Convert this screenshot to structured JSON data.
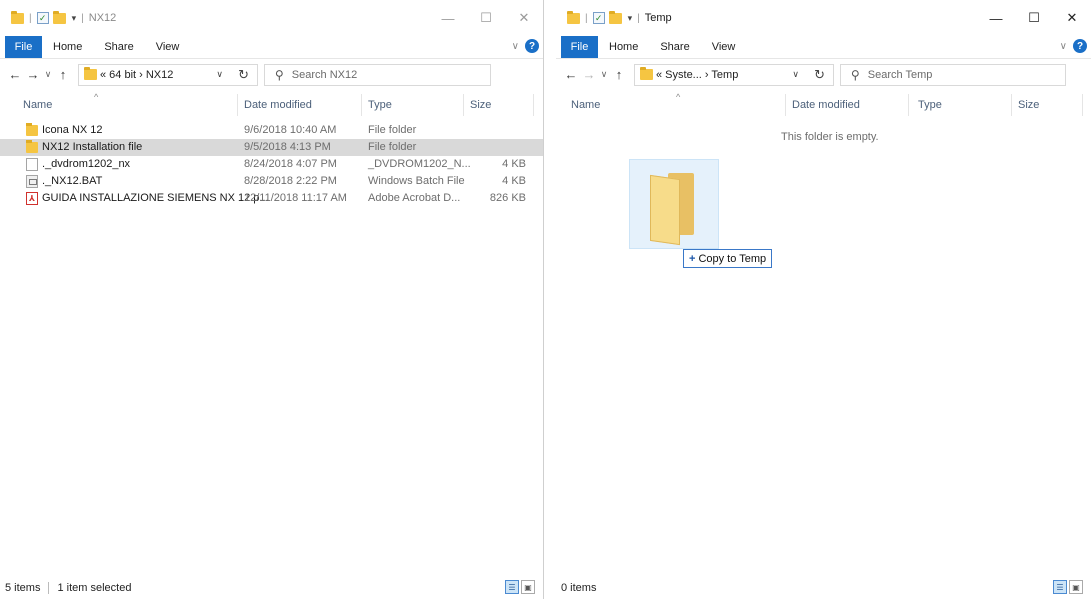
{
  "left": {
    "title": "NX12",
    "ribbon": {
      "file": "File",
      "home": "Home",
      "share": "Share",
      "view": "View"
    },
    "address": {
      "crumbs": "« 64 bit › NX12"
    },
    "search": {
      "placeholder": "Search NX12"
    },
    "columns": {
      "name": "Name",
      "date": "Date modified",
      "type": "Type",
      "size": "Size"
    },
    "files": [
      {
        "name": "Icona NX 12",
        "date": "9/6/2018 10:40 AM",
        "type": "File folder",
        "size": "",
        "icon": "folder"
      },
      {
        "name": "NX12 Installation file",
        "date": "9/5/2018 4:13 PM",
        "type": "File folder",
        "size": "",
        "icon": "folder",
        "selected": true
      },
      {
        "name": "._dvdrom1202_nx",
        "date": "8/24/2018 4:07 PM",
        "type": "_DVDROM1202_N...",
        "size": "4 KB",
        "icon": "file"
      },
      {
        "name": "._NX12.BAT",
        "date": "8/28/2018 2:22 PM",
        "type": "Windows Batch File",
        "size": "4 KB",
        "icon": "bat"
      },
      {
        "name": "GUIDA INSTALLAZIONE SIEMENS NX 12.p...",
        "date": "12/11/2018 11:17 AM",
        "type": "Adobe Acrobat D...",
        "size": "826 KB",
        "icon": "pdf"
      }
    ],
    "status": {
      "count": "5 items",
      "selected": "1 item selected"
    }
  },
  "right": {
    "title": "Temp",
    "ribbon": {
      "file": "File",
      "home": "Home",
      "share": "Share",
      "view": "View"
    },
    "address": {
      "crumbs": "« Syste... › Temp"
    },
    "search": {
      "placeholder": "Search Temp"
    },
    "columns": {
      "name": "Name",
      "date": "Date modified",
      "type": "Type",
      "size": "Size"
    },
    "empty_message": "This folder is empty.",
    "status": {
      "count": "0 items"
    }
  },
  "drag": {
    "tooltip": "Copy to Temp",
    "plus": "+"
  },
  "colors": {
    "accent": "#1a6fc7",
    "folder": "#f5c542",
    "selection": "#d9d9d9"
  }
}
